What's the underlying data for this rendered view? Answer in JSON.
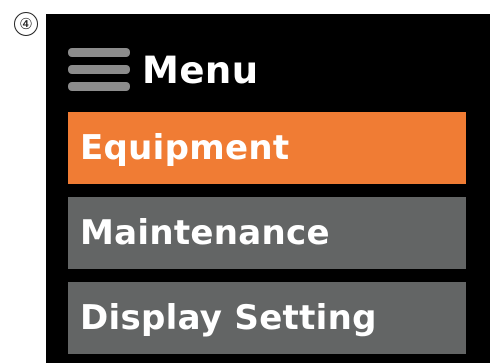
{
  "step_marker": "④",
  "header": {
    "title": "Menu",
    "icon": "hamburger-menu-icon"
  },
  "menu": {
    "items": [
      {
        "label": "Equipment",
        "selected": true
      },
      {
        "label": "Maintenance",
        "selected": false
      },
      {
        "label": "Display Setting",
        "selected": false
      }
    ]
  },
  "colors": {
    "screen_background": "#000000",
    "selected_item": "#f07c34",
    "unselected_item": "#636565",
    "text": "#ffffff",
    "hamburger_icon": "#8c8c8c"
  }
}
